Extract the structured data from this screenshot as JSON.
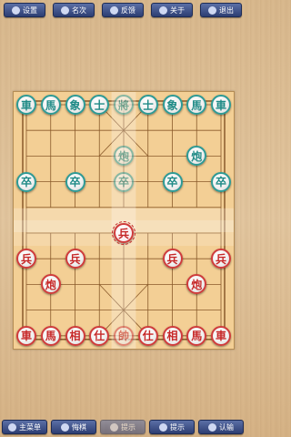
{
  "toolbar_top": [
    {
      "name": "settings-button",
      "label": "设置",
      "icon": "gear-icon"
    },
    {
      "name": "rankings-button",
      "label": "名次",
      "icon": "chat-icon"
    },
    {
      "name": "feedback-button",
      "label": "反馈",
      "icon": "mail-icon"
    },
    {
      "name": "about-button",
      "label": "关于",
      "icon": "home-icon"
    },
    {
      "name": "exit-button",
      "label": "退出",
      "icon": "exit-icon"
    }
  ],
  "toolbar_bottom": [
    {
      "name": "main-menu-button",
      "label": "主菜单",
      "icon": "home-icon",
      "enabled": true
    },
    {
      "name": "undo-button",
      "label": "悔棋",
      "icon": "back-icon",
      "enabled": true
    },
    {
      "name": "disabled-button",
      "label": "提示",
      "icon": "hint-icon",
      "enabled": false
    },
    {
      "name": "hint-button",
      "label": "提示",
      "icon": "lightbulb-icon",
      "enabled": true
    },
    {
      "name": "resign-button",
      "label": "认输",
      "icon": "flag-icon",
      "enabled": true
    }
  ],
  "pieces": [
    {
      "char": "車",
      "side": "green",
      "col": 0,
      "row": 0
    },
    {
      "char": "馬",
      "side": "green",
      "col": 1,
      "row": 0
    },
    {
      "char": "象",
      "side": "green",
      "col": 2,
      "row": 0
    },
    {
      "char": "士",
      "side": "green",
      "col": 3,
      "row": 0
    },
    {
      "char": "將",
      "side": "green",
      "col": 4,
      "row": 0,
      "faded": true
    },
    {
      "char": "士",
      "side": "green",
      "col": 5,
      "row": 0
    },
    {
      "char": "象",
      "side": "green",
      "col": 6,
      "row": 0
    },
    {
      "char": "馬",
      "side": "green",
      "col": 7,
      "row": 0
    },
    {
      "char": "車",
      "side": "green",
      "col": 8,
      "row": 0
    },
    {
      "char": "炮",
      "side": "green",
      "col": 4,
      "row": 2,
      "faded": true
    },
    {
      "char": "炮",
      "side": "green",
      "col": 7,
      "row": 2
    },
    {
      "char": "卒",
      "side": "green",
      "col": 0,
      "row": 3
    },
    {
      "char": "卒",
      "side": "green",
      "col": 2,
      "row": 3
    },
    {
      "char": "卒",
      "side": "green",
      "col": 4,
      "row": 3,
      "faded": true
    },
    {
      "char": "卒",
      "side": "green",
      "col": 6,
      "row": 3
    },
    {
      "char": "卒",
      "side": "green",
      "col": 8,
      "row": 3
    },
    {
      "char": "兵",
      "side": "red",
      "col": 4,
      "row": 5,
      "selected": true
    },
    {
      "char": "兵",
      "side": "red",
      "col": 0,
      "row": 6
    },
    {
      "char": "兵",
      "side": "red",
      "col": 2,
      "row": 6
    },
    {
      "char": "兵",
      "side": "red",
      "col": 6,
      "row": 6
    },
    {
      "char": "兵",
      "side": "red",
      "col": 8,
      "row": 6
    },
    {
      "char": "炮",
      "side": "red",
      "col": 1,
      "row": 7
    },
    {
      "char": "炮",
      "side": "red",
      "col": 7,
      "row": 7
    },
    {
      "char": "車",
      "side": "red",
      "col": 0,
      "row": 9
    },
    {
      "char": "馬",
      "side": "red",
      "col": 1,
      "row": 9
    },
    {
      "char": "相",
      "side": "red",
      "col": 2,
      "row": 9
    },
    {
      "char": "仕",
      "side": "red",
      "col": 3,
      "row": 9
    },
    {
      "char": "帥",
      "side": "red",
      "col": 4,
      "row": 9,
      "faded": true
    },
    {
      "char": "仕",
      "side": "red",
      "col": 5,
      "row": 9
    },
    {
      "char": "相",
      "side": "red",
      "col": 6,
      "row": 9
    },
    {
      "char": "馬",
      "side": "red",
      "col": 7,
      "row": 9
    },
    {
      "char": "車",
      "side": "red",
      "col": 8,
      "row": 9
    }
  ]
}
